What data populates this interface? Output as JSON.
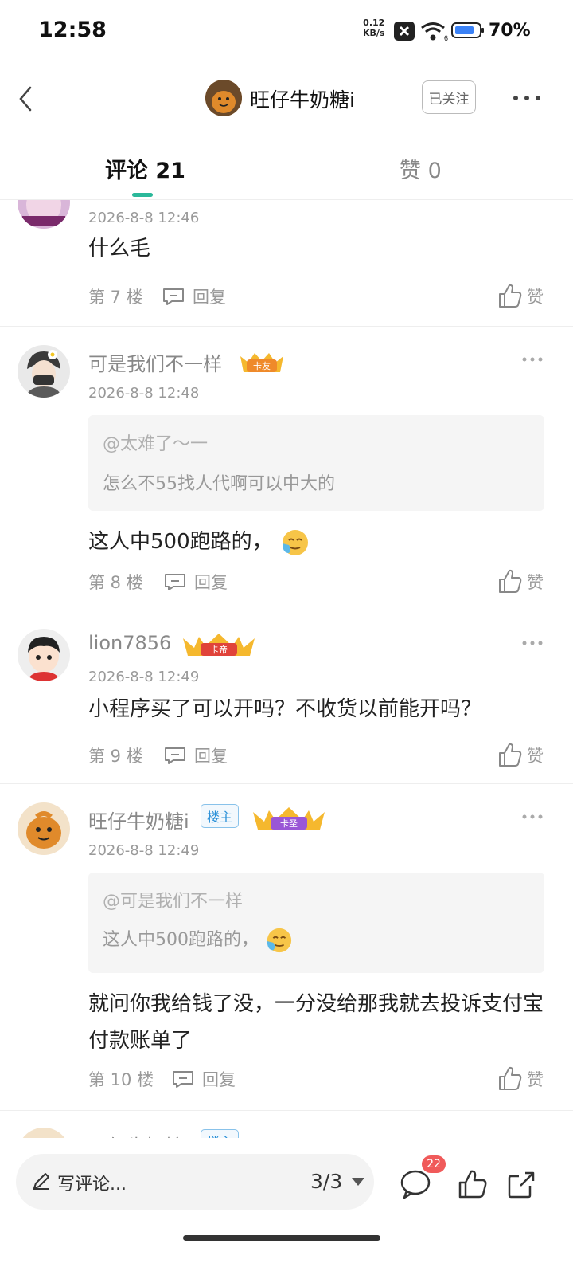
{
  "status_bar": {
    "time": "12:58",
    "net_speed": "0.12",
    "net_unit": "KB/s",
    "battery": "70%"
  },
  "header": {
    "name": "旺仔牛奶糖i",
    "follow_label": "已关注"
  },
  "tabs": [
    {
      "label": "评论 21"
    },
    {
      "label": "赞 0"
    }
  ],
  "reply_label": "回复",
  "like_label": "赞",
  "comments": [
    {
      "date": "2026-8-8 12:46",
      "text": "什么毛",
      "floor": "第 7 楼"
    },
    {
      "user": "可是我们不一样",
      "badge": "卡友",
      "date": "2026-8-8 12:48",
      "quote_user": "@太难了～一",
      "quote_text": "怎么不55找人代啊可以中大的",
      "text": "这人中500跑路的，",
      "floor": "第 8 楼"
    },
    {
      "user": "lion7856",
      "badge": "卡帝",
      "date": "2026-8-8 12:49",
      "text": "小程序买了可以开吗？不收货以前能开吗？",
      "floor": "第 9 楼"
    },
    {
      "user": "旺仔牛奶糖i",
      "tag": "楼主",
      "badge": "卡圣",
      "date": "2026-8-8 12:49",
      "quote_user": "@可是我们不一样",
      "quote_text": "这人中500跑路的，",
      "text": "就问你我给钱了没，一分没给那我就去投诉支付宝付款账单了",
      "floor": "第 10 楼"
    },
    {
      "user": "旺仔牛奶糖i",
      "tag": "楼主"
    }
  ],
  "bottom_bar": {
    "placeholder": "写评论...",
    "page": "3/3",
    "comment_count": "22"
  },
  "colors": {
    "accent": "#2bb89a",
    "badge_red": "#f05a5a",
    "louzhu_blue": "#2a90d8"
  }
}
